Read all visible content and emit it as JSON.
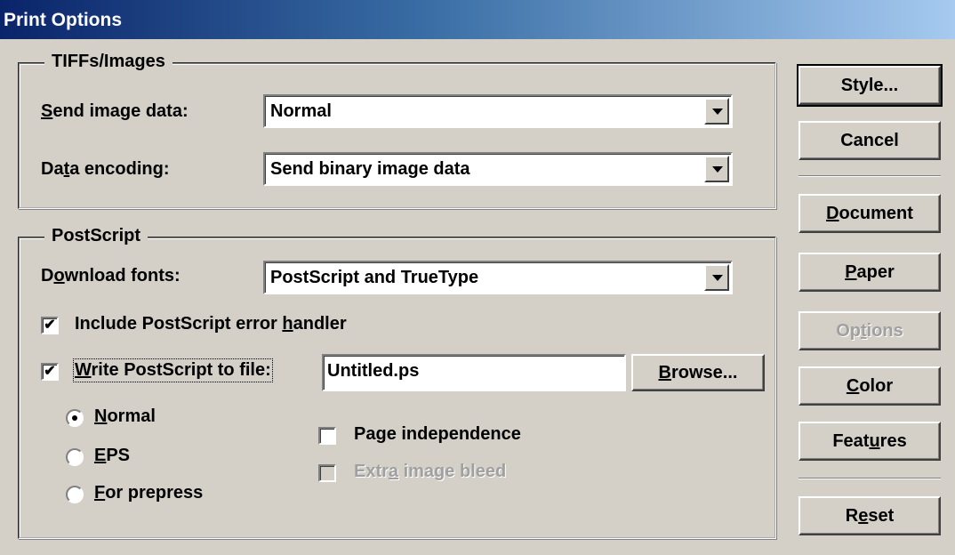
{
  "window": {
    "title": "Print Options"
  },
  "tiffs": {
    "legend": "TIFFs/Images",
    "send_label": "Send image data:",
    "send_value": "Normal",
    "encoding_label": "Data encoding:",
    "encoding_value": "Send binary image data"
  },
  "postscript": {
    "legend": "PostScript",
    "fonts_label": "Download fonts:",
    "fonts_value": "PostScript and TrueType",
    "error_handler_label": "Include PostScript error handler",
    "error_handler_checked": true,
    "write_file_label": "Write PostScript to file",
    "write_file_checked": true,
    "filename": "Untitled.ps",
    "browse_label": "Browse...",
    "radio_normal": "Normal",
    "radio_eps": "EPS",
    "radio_prepress": "For prepress",
    "radio_selected": "Normal",
    "page_independence": "Page independence",
    "extra_bleed": "Extra image bleed"
  },
  "buttons": {
    "style": "Style...",
    "cancel": "Cancel",
    "document": "Document",
    "paper": "Paper",
    "options": "Options",
    "color": "Color",
    "features": "Features",
    "reset": "Reset"
  },
  "icons": {
    "dropdown": "chevron-down-icon",
    "check": "checkmark-icon",
    "radio_dot": "radio-dot-icon"
  },
  "colors": {
    "dialog_bg": "#d4d0c8",
    "titlebar_start": "#0a246a",
    "titlebar_end": "#a6caf0",
    "disabled_text": "#a0a0a0"
  }
}
